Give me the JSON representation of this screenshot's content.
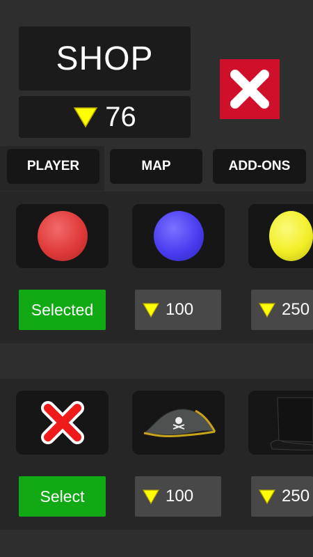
{
  "header": {
    "title": "SHOP",
    "coins": "76"
  },
  "tabs": [
    {
      "label": "PLAYER"
    },
    {
      "label": "MAP"
    },
    {
      "label": "ADD-ONS"
    }
  ],
  "colors_section": {
    "items": [
      {
        "color": "#e83c3c",
        "action": "Selected"
      },
      {
        "color": "#4a3df0",
        "price": "100"
      },
      {
        "color": "#f2ef28",
        "price": "250"
      }
    ]
  },
  "hats_section": {
    "items": [
      {
        "icon": "no-hat-icon",
        "action": "Select"
      },
      {
        "icon": "pirate-hat-icon",
        "price": "100"
      },
      {
        "icon": "top-hat-icon",
        "price": "250"
      }
    ]
  },
  "theme": {
    "accent_green": "#11aa15",
    "close_red": "#d0102a",
    "coin_yellow": "#ffff00"
  }
}
